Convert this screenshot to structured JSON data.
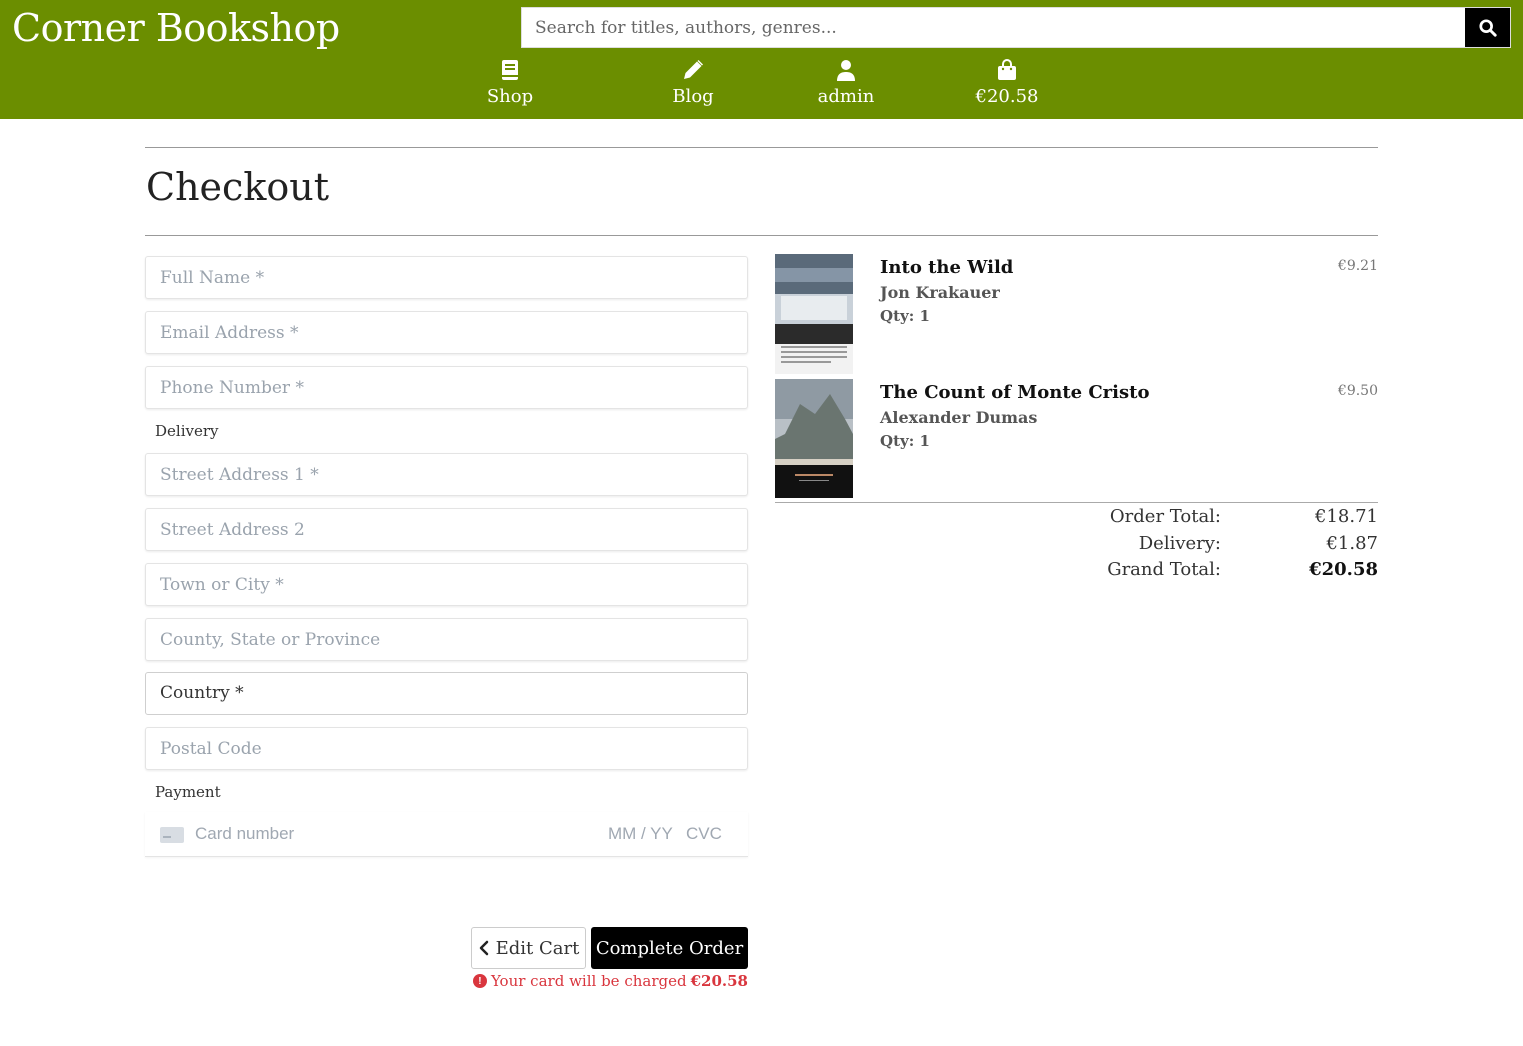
{
  "header": {
    "brand": "Corner Bookshop",
    "search_placeholder": "Search for titles, authors, genres...",
    "nav": {
      "shop": "Shop",
      "blog": "Blog",
      "account": "admin",
      "cart_total": "€20.58"
    }
  },
  "page": {
    "title": "Checkout"
  },
  "form": {
    "full_name": "Full Name *",
    "email": "Email Address *",
    "phone": "Phone Number *",
    "delivery_label": "Delivery",
    "street1": "Street Address 1 *",
    "street2": "Street Address 2",
    "town": "Town or City *",
    "county": "County, State or Province",
    "country": "Country *",
    "postcode": "Postal Code",
    "payment_label": "Payment",
    "card_number": "Card number",
    "card_expiry": "MM / YY",
    "card_cvc": "CVC"
  },
  "actions": {
    "edit_cart": "Edit Cart",
    "complete_order": "Complete Order",
    "charge_text": "Your card will be charged",
    "charge_amount": "€20.58"
  },
  "order": {
    "items": [
      {
        "title": "Into the Wild",
        "author": "Jon Krakauer",
        "qty": "Qty: 1",
        "price": "€9.21"
      },
      {
        "title": "The Count of Monte Cristo",
        "author": "Alexander Dumas",
        "qty": "Qty: 1",
        "price": "€9.50"
      }
    ],
    "order_total_label": "Order Total:",
    "order_total": "€18.71",
    "delivery_label": "Delivery:",
    "delivery": "€1.87",
    "grand_total_label": "Grand Total:",
    "grand_total": "€20.58"
  },
  "colors": {
    "header_bg": "#6b8e00",
    "accent_dark": "#000000",
    "error": "#d9363e"
  }
}
